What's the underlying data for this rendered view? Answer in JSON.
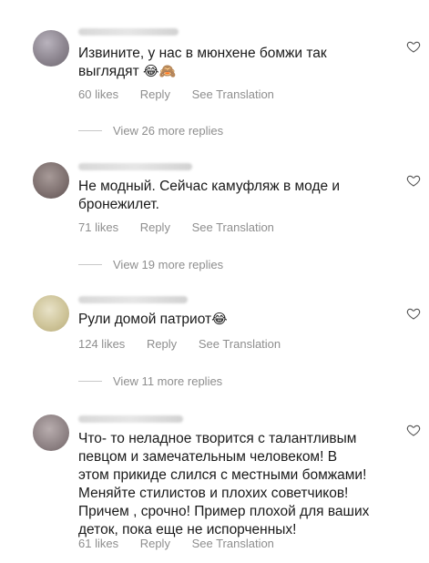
{
  "comments": [
    {
      "text": "Извините, у нас в мюнхене бомжи так выглядят",
      "emoji": "😂🙈",
      "likes": "60 likes",
      "reply": "Reply",
      "translation": "See Translation",
      "view_replies": "View 26 more replies",
      "heart_icon": "heart-outline-icon"
    },
    {
      "text": "Не модный. Сейчас камуфляж в моде и бронежилет.",
      "emoji": "",
      "likes": "71 likes",
      "reply": "Reply",
      "translation": "See Translation",
      "view_replies": "View 19 more replies",
      "heart_icon": "heart-outline-icon"
    },
    {
      "text": "Рули домой патриот",
      "emoji": "😂",
      "likes": "124 likes",
      "reply": "Reply",
      "translation": "See Translation",
      "view_replies": "View 11 more replies",
      "heart_icon": "heart-outline-icon"
    },
    {
      "text": "Что- то неладное творится с талантливым певцом и замечательным человеком! В этом прикиде слился с местными бомжами! Меняйте стилистов и плохих советчиков! Причем , срочно! Пример плохой для ваших деток, пока еще не испорченных!",
      "emoji": "",
      "likes": "61 likes",
      "reply": "Reply",
      "translation": "See Translation",
      "heart_icon": "heart-outline-icon"
    }
  ]
}
